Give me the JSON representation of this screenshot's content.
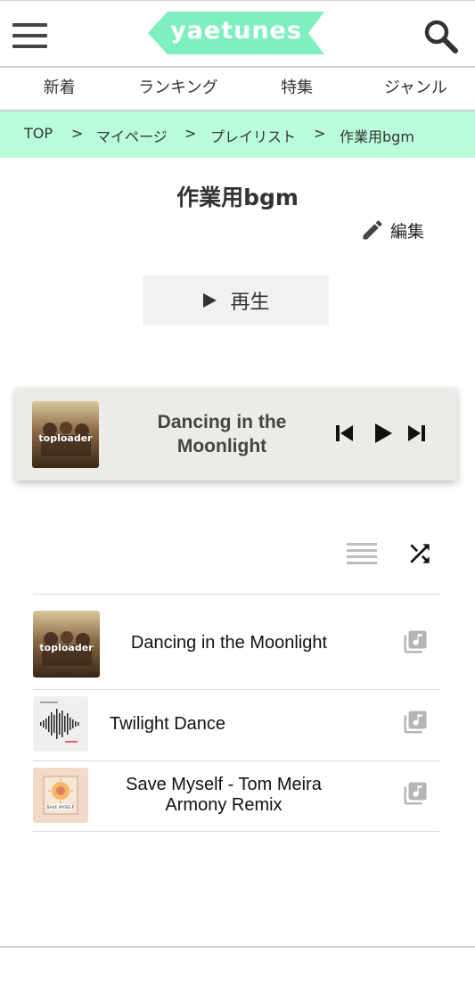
{
  "header": {
    "menu_icon": "hamburger-menu-icon",
    "logo_text": "yaetunes",
    "logo_color": "#7ef0c0",
    "search_icon": "search-icon"
  },
  "nav": {
    "items": [
      "新着",
      "ランキング",
      "特集",
      "ジャンル"
    ]
  },
  "breadcrumb": {
    "items": [
      "TOP",
      "マイページ",
      "プレイリスト",
      "作業用bgm"
    ],
    "separator": ">",
    "background": "#b9fddc"
  },
  "playlist": {
    "title": "作業用bgm",
    "edit_label": "編集",
    "edit_icon": "pencil-icon",
    "play_label": "再生",
    "play_icon": "play-icon"
  },
  "player": {
    "now_playing_title": "Dancing in the Moonlight",
    "art_label": "toploader",
    "controls": [
      "skip-previous-icon",
      "play-icon",
      "skip-next-icon"
    ]
  },
  "list_tools": {
    "list_icon": "list-icon",
    "shuffle_icon": "shuffle-icon"
  },
  "tracks": [
    {
      "title": "Dancing in the Moonlight",
      "art_label": "toploader",
      "action_icon": "add-to-library-icon"
    },
    {
      "title": "Twilight Dance",
      "art_label": "Twilight Dance cover",
      "action_icon": "add-to-library-icon"
    },
    {
      "title": "Save Myself - Tom Meira Armony Remix",
      "art_label": "SAVE MYSELF",
      "action_icon": "add-to-library-icon"
    }
  ]
}
